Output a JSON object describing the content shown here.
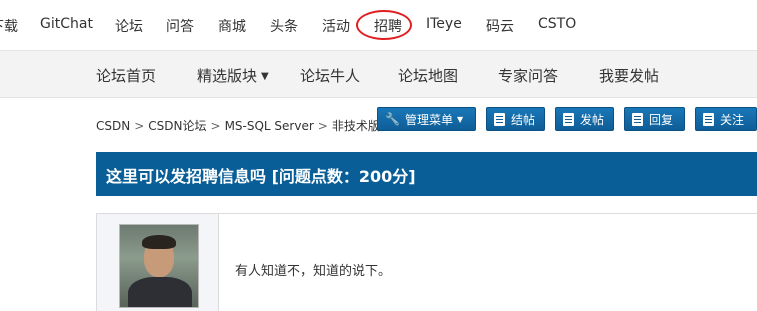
{
  "topnav": {
    "items": [
      "下载",
      "GitChat",
      "论坛",
      "问答",
      "商城",
      "头条",
      "活动",
      "招聘",
      "ITeye",
      "码云",
      "CSTO"
    ]
  },
  "subnav": {
    "items": [
      "论坛首页",
      "精选版块",
      "论坛牛人",
      "论坛地图",
      "专家问答",
      "我要发帖"
    ]
  },
  "breadcrumb": [
    "CSDN",
    "CSDN论坛",
    "MS-SQL Server",
    "非技术版"
  ],
  "toolbar": {
    "manage": "管理菜单",
    "close": "结帖",
    "post": "发帖",
    "reply": "回复",
    "follow": "关注"
  },
  "thread": {
    "title": "这里可以发招聘信息吗 [问题点数：200分]",
    "content": "有人知道不，知道的说下。"
  },
  "colors": {
    "accent": "#0a5e97",
    "highlight_circle": "#e02020"
  }
}
